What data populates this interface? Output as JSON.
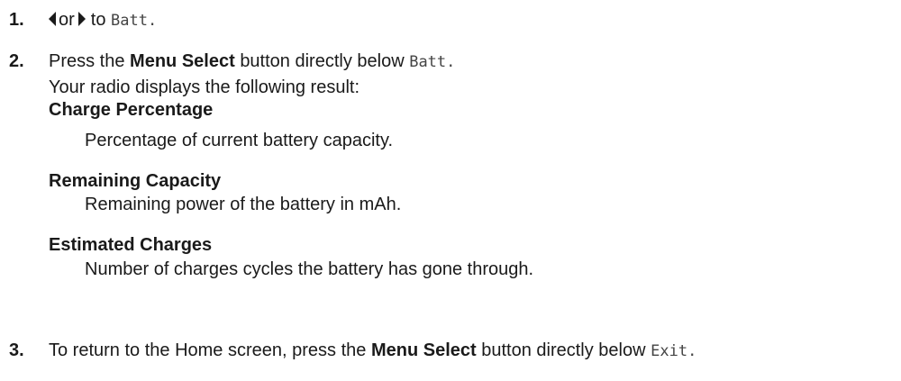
{
  "steps": [
    {
      "number": "1.",
      "text_or": "or",
      "text_to": "to",
      "code": "Batt.",
      "icons": [
        "left-arrow-icon",
        "right-arrow-icon"
      ]
    },
    {
      "number": "2.",
      "text_before": "Press the",
      "bold": "Menu Select",
      "text_after": "button directly below",
      "code": "Batt."
    },
    {
      "number": "3.",
      "text_before": "To return to the Home screen, press the",
      "bold": "Menu Select",
      "text_after": "button directly below",
      "code": "Exit."
    }
  ],
  "result": {
    "intro": "Your radio displays the following result:",
    "items": [
      {
        "term": "Charge Percentage",
        "description": "Percentage of current battery capacity."
      },
      {
        "term": "Remaining Capacity",
        "description": "Remaining power of the battery in mAh."
      },
      {
        "term": "Estimated Charges",
        "description": "Number of charges cycles the battery has gone through."
      }
    ]
  }
}
